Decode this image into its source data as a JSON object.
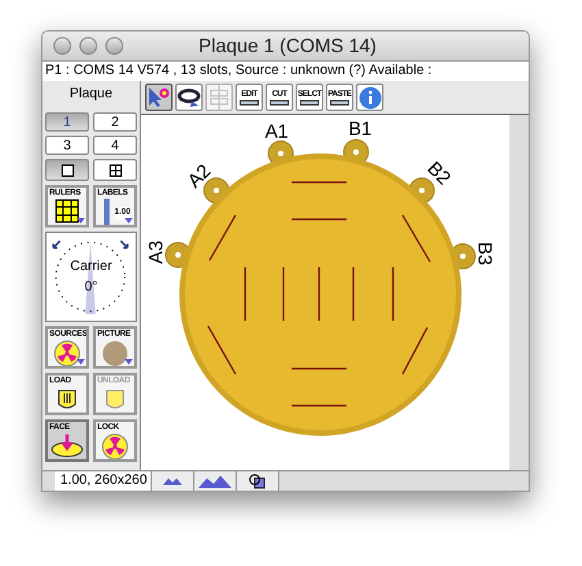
{
  "window": {
    "title": "Plaque 1 (COMS 14)"
  },
  "info_line": "P1 : COMS 14 V574 , 13 slots, Source : unknown (?) Available :",
  "sidebar": {
    "label": "Plaque",
    "plaque_buttons": [
      {
        "label": "1",
        "selected": true
      },
      {
        "label": "2",
        "selected": false
      },
      {
        "label": "3",
        "selected": false
      },
      {
        "label": "4",
        "selected": false
      }
    ],
    "view_buttons": [
      {
        "kind": "single",
        "selected": true
      },
      {
        "kind": "grid",
        "selected": false
      }
    ],
    "tools": [
      {
        "kind": "rulers",
        "label": "RULERS",
        "menu": true,
        "disabled": false,
        "selected": false
      },
      {
        "kind": "labels",
        "label": "LABELS",
        "value": "1.00",
        "menu": true,
        "disabled": false,
        "selected": false
      },
      {
        "kind": "sources",
        "label": "SOURCES",
        "menu": true,
        "disabled": false,
        "selected": false
      },
      {
        "kind": "picture",
        "label": "PICTURE",
        "menu": true,
        "disabled": false,
        "selected": false
      },
      {
        "kind": "load",
        "label": "LOAD",
        "menu": false,
        "disabled": false,
        "selected": false
      },
      {
        "kind": "unload",
        "label": "UNLOAD",
        "menu": false,
        "disabled": true,
        "selected": false
      },
      {
        "kind": "face",
        "label": "FACE",
        "menu": false,
        "disabled": false,
        "selected": true
      },
      {
        "kind": "lock",
        "label": "LOCK",
        "menu": false,
        "disabled": false,
        "selected": false
      }
    ],
    "dial": {
      "label": "Carrier",
      "angle": "0°"
    }
  },
  "toolbar": [
    {
      "kind": "pointer",
      "selected": true,
      "disabled": false
    },
    {
      "kind": "rotate",
      "selected": false,
      "disabled": false
    },
    {
      "kind": "align",
      "selected": false,
      "disabled": true
    },
    {
      "kind": "edit",
      "label": "EDIT",
      "selected": false,
      "disabled": false
    },
    {
      "kind": "cut",
      "label": "CUT",
      "selected": false,
      "disabled": false
    },
    {
      "kind": "select",
      "label": "SELCT",
      "selected": false,
      "disabled": false
    },
    {
      "kind": "paste",
      "label": "PASTE",
      "selected": false,
      "disabled": false
    },
    {
      "kind": "info",
      "selected": false,
      "disabled": false
    }
  ],
  "canvas": {
    "slots": [
      "A1",
      "B1",
      "A2",
      "B2",
      "A3",
      "B3"
    ]
  },
  "status_bar": {
    "zoom": "1.00, 260x260",
    "buttons": [
      {
        "kind": "zoom-out"
      },
      {
        "kind": "zoom-in"
      },
      {
        "kind": "fit"
      }
    ]
  }
}
